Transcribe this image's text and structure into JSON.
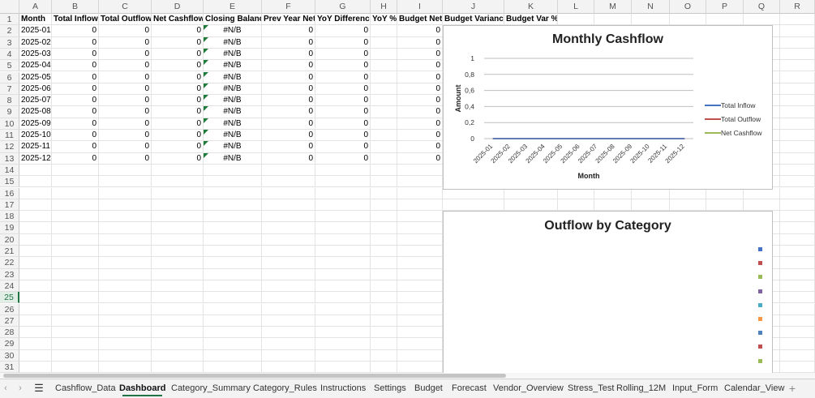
{
  "columns": [
    "A",
    "B",
    "C",
    "D",
    "E",
    "F",
    "G",
    "H",
    "I",
    "J",
    "K",
    "L",
    "M",
    "N",
    "O",
    "P",
    "Q",
    "R"
  ],
  "headers": [
    "Month",
    "Total Inflow",
    "Total Outflow",
    "Net Cashflow",
    "Closing Balance",
    "Prev Year Net",
    "YoY Difference",
    "YoY %",
    "Budget Net",
    "Budget Variance",
    "Budget Var %"
  ],
  "rows": [
    {
      "month": "2025-01",
      "inflow": "0",
      "outflow": "0",
      "net": "0",
      "closing": "#N/B",
      "prev": "0",
      "yoy": "0",
      "budget": "0"
    },
    {
      "month": "2025-02",
      "inflow": "0",
      "outflow": "0",
      "net": "0",
      "closing": "#N/B",
      "prev": "0",
      "yoy": "0",
      "budget": "0"
    },
    {
      "month": "2025-03",
      "inflow": "0",
      "outflow": "0",
      "net": "0",
      "closing": "#N/B",
      "prev": "0",
      "yoy": "0",
      "budget": "0"
    },
    {
      "month": "2025-04",
      "inflow": "0",
      "outflow": "0",
      "net": "0",
      "closing": "#N/B",
      "prev": "0",
      "yoy": "0",
      "budget": "0"
    },
    {
      "month": "2025-05",
      "inflow": "0",
      "outflow": "0",
      "net": "0",
      "closing": "#N/B",
      "prev": "0",
      "yoy": "0",
      "budget": "0"
    },
    {
      "month": "2025-06",
      "inflow": "0",
      "outflow": "0",
      "net": "0",
      "closing": "#N/B",
      "prev": "0",
      "yoy": "0",
      "budget": "0"
    },
    {
      "month": "2025-07",
      "inflow": "0",
      "outflow": "0",
      "net": "0",
      "closing": "#N/B",
      "prev": "0",
      "yoy": "0",
      "budget": "0"
    },
    {
      "month": "2025-08",
      "inflow": "0",
      "outflow": "0",
      "net": "0",
      "closing": "#N/B",
      "prev": "0",
      "yoy": "0",
      "budget": "0"
    },
    {
      "month": "2025-09",
      "inflow": "0",
      "outflow": "0",
      "net": "0",
      "closing": "#N/B",
      "prev": "0",
      "yoy": "0",
      "budget": "0"
    },
    {
      "month": "2025-10",
      "inflow": "0",
      "outflow": "0",
      "net": "0",
      "closing": "#N/B",
      "prev": "0",
      "yoy": "0",
      "budget": "0"
    },
    {
      "month": "2025-11",
      "inflow": "0",
      "outflow": "0",
      "net": "0",
      "closing": "#N/B",
      "prev": "0",
      "yoy": "0",
      "budget": "0"
    },
    {
      "month": "2025-12",
      "inflow": "0",
      "outflow": "0",
      "net": "0",
      "closing": "#N/B",
      "prev": "0",
      "yoy": "0",
      "budget": "0"
    }
  ],
  "row_count": 31,
  "active_row": 25,
  "chart_data": [
    {
      "type": "line",
      "title": "Monthly Cashflow",
      "xlabel": "Month",
      "ylabel": "Amount",
      "categories": [
        "2025-01",
        "2025-02",
        "2025-03",
        "2025-04",
        "2025-05",
        "2025-06",
        "2025-07",
        "2025-08",
        "2025-09",
        "2025-10",
        "2025-11",
        "2025-12"
      ],
      "yticks": [
        "0",
        "0,2",
        "0,4",
        "0,6",
        "0,8",
        "1"
      ],
      "ylim": [
        0,
        1
      ],
      "series": [
        {
          "name": "Total Inflow",
          "color": "#4472c4",
          "values": [
            0,
            0,
            0,
            0,
            0,
            0,
            0,
            0,
            0,
            0,
            0,
            0
          ]
        },
        {
          "name": "Total Outflow",
          "color": "#c0504d",
          "values": [
            0,
            0,
            0,
            0,
            0,
            0,
            0,
            0,
            0,
            0,
            0,
            0
          ]
        },
        {
          "name": "Net Cashflow",
          "color": "#9bbb59",
          "values": [
            0,
            0,
            0,
            0,
            0,
            0,
            0,
            0,
            0,
            0,
            0,
            0
          ]
        }
      ],
      "grid": true,
      "legend": "right"
    },
    {
      "type": "pie",
      "title": "Outflow by Category",
      "legend": "right",
      "legend_colors": [
        "#4472c4",
        "#c0504d",
        "#9bbb59",
        "#8064a2",
        "#4bacc6",
        "#f79646",
        "#4f81bd",
        "#c0504d",
        "#9bbb59"
      ]
    }
  ],
  "tabs": [
    "Cashflow_Data",
    "Dashboard",
    "Category_Summary",
    "Category_Rules",
    "Instructions",
    "Settings",
    "Budget",
    "Forecast",
    "Vendor_Overview",
    "Stress_Test",
    "Rolling_12M",
    "Input_Form",
    "Calendar_View"
  ],
  "active_tab": "Dashboard",
  "nav": {
    "prev": "‹",
    "next": "›",
    "menu": "☰",
    "add": "+"
  }
}
